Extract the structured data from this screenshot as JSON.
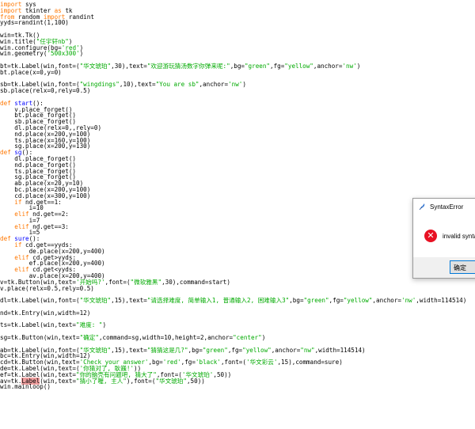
{
  "editor": {
    "lines": [
      [
        [
          "kw",
          "import"
        ],
        [
          "t",
          " sys"
        ]
      ],
      [
        [
          "kw",
          "import"
        ],
        [
          "t",
          " tkinter "
        ],
        [
          "kw",
          "as"
        ],
        [
          "t",
          " tk"
        ]
      ],
      [
        [
          "kw",
          "from"
        ],
        [
          "t",
          " random "
        ],
        [
          "kw",
          "import"
        ],
        [
          "t",
          " randint"
        ]
      ],
      [
        [
          "t",
          "yyds=randint(1,100)"
        ]
      ],
      [],
      [
        [
          "t",
          "win=tk.Tk()"
        ]
      ],
      [
        [
          "t",
          "win.title("
        ],
        [
          "st",
          "\"任宇轩nb\""
        ],
        [
          "t",
          ")"
        ]
      ],
      [
        [
          "t",
          "win.configure(bg="
        ],
        [
          "st",
          "'red'"
        ],
        [
          "t",
          ")"
        ]
      ],
      [
        [
          "t",
          "win.geometry("
        ],
        [
          "st",
          "'500x300'"
        ],
        [
          "t",
          ")"
        ]
      ],
      [],
      [
        [
          "t",
          "bt=tk.Label(win,font=("
        ],
        [
          "st",
          "\"华文琥珀\""
        ],
        [
          "t",
          ",30),text="
        ],
        [
          "st",
          "\"欢迎游玩猜汤数字你弹来呢:\""
        ],
        [
          "t",
          ",bg="
        ],
        [
          "st",
          "\"green\""
        ],
        [
          "t",
          ",fg="
        ],
        [
          "st",
          "\"yellow\""
        ],
        [
          "t",
          ",anchor="
        ],
        [
          "st",
          "'nw'"
        ],
        [
          "t",
          ")"
        ]
      ],
      [
        [
          "t",
          "bt.place(x=0,y=0)"
        ]
      ],
      [],
      [
        [
          "t",
          "sb=tk.Label(win,font=("
        ],
        [
          "st",
          "\"wingdings\""
        ],
        [
          "t",
          ",10),text="
        ],
        [
          "st",
          "\"You are sb\""
        ],
        [
          "t",
          ",anchor="
        ],
        [
          "st",
          "'nw'"
        ],
        [
          "t",
          ")"
        ]
      ],
      [
        [
          "t",
          "sb.place(relx=0,rely=0.5)"
        ]
      ],
      [],
      [
        [
          "kw",
          "def"
        ],
        [
          "t",
          " "
        ],
        [
          "fn",
          "start"
        ],
        [
          "t",
          "():"
        ]
      ],
      [
        [
          "t",
          "    v.place_forget()"
        ]
      ],
      [
        [
          "t",
          "    bt.place_forget()"
        ]
      ],
      [
        [
          "t",
          "    sb.place_forget()"
        ]
      ],
      [
        [
          "t",
          "    dl.place(relx=0,,rely=0)"
        ]
      ],
      [
        [
          "t",
          "    nd.place(x=200,y=100)"
        ]
      ],
      [
        [
          "t",
          "    ts.place(x=160,y=100)"
        ]
      ],
      [
        [
          "t",
          "    sg.place(x=200,y=130)"
        ]
      ],
      [
        [
          "kw",
          "def"
        ],
        [
          "t",
          " "
        ],
        [
          "fn",
          "sg"
        ],
        [
          "t",
          "():"
        ]
      ],
      [
        [
          "t",
          "    dl.place_forget()"
        ]
      ],
      [
        [
          "t",
          "    nd.place_forget()"
        ]
      ],
      [
        [
          "t",
          "    ts.place_forget()"
        ]
      ],
      [
        [
          "t",
          "    sg.place_forget()"
        ]
      ],
      [
        [
          "t",
          "    ab.place(x=20,y=10)"
        ]
      ],
      [
        [
          "t",
          "    bc.place(x=200,y=100)"
        ]
      ],
      [
        [
          "t",
          "    cd.place(x=300,y=100)"
        ]
      ],
      [
        [
          "t",
          "    "
        ],
        [
          "kw",
          "if"
        ],
        [
          "t",
          " nd.get==1:"
        ]
      ],
      [
        [
          "t",
          "        i=10"
        ]
      ],
      [
        [
          "t",
          "    "
        ],
        [
          "kw",
          "elif"
        ],
        [
          "t",
          " nd.get==2:"
        ]
      ],
      [
        [
          "t",
          "        i=7"
        ]
      ],
      [
        [
          "t",
          "    "
        ],
        [
          "kw",
          "elif"
        ],
        [
          "t",
          " nd.get==3:"
        ]
      ],
      [
        [
          "t",
          "        i=5"
        ]
      ],
      [
        [
          "kw",
          "def"
        ],
        [
          "t",
          " "
        ],
        [
          "fn",
          "sure"
        ],
        [
          "t",
          "():"
        ]
      ],
      [
        [
          "t",
          "    "
        ],
        [
          "kw",
          "if"
        ],
        [
          "t",
          " cd.get==yyds:"
        ]
      ],
      [
        [
          "t",
          "        de.place(x=200,y=400)"
        ]
      ],
      [
        [
          "t",
          "    "
        ],
        [
          "kw",
          "elif"
        ],
        [
          "t",
          " cd.get>yyds:"
        ]
      ],
      [
        [
          "t",
          "        ef.place(x=200,y=400)"
        ]
      ],
      [
        [
          "t",
          "    "
        ],
        [
          "kw",
          "elif"
        ],
        [
          "t",
          " cd.get<yyds:"
        ]
      ],
      [
        [
          "t",
          "        av.place(x=200,y=400)"
        ]
      ],
      [
        [
          "t",
          "v=tk.Button(win,text="
        ],
        [
          "st",
          "'开始吗?'"
        ],
        [
          "t",
          ",font=("
        ],
        [
          "st",
          "\"微软雅黑\""
        ],
        [
          "t",
          ",30),command=start)"
        ]
      ],
      [
        [
          "t",
          "v.place(relx=0.5,rely=0.5)"
        ]
      ],
      [],
      [
        [
          "t",
          "dl=tk.Label(win,font=("
        ],
        [
          "st",
          "\"华文琥珀\""
        ],
        [
          "t",
          ",15),text="
        ],
        [
          "st",
          "\"请选择难度, 简单输入1, 普通输入2, 困难输入3\""
        ],
        [
          "t",
          ",bg="
        ],
        [
          "st",
          "\"green\""
        ],
        [
          "t",
          ",fg="
        ],
        [
          "st",
          "\"yellow\""
        ],
        [
          "t",
          ",anchor="
        ],
        [
          "st",
          "'nw'"
        ],
        [
          "t",
          ",width=114514)"
        ]
      ],
      [],
      [
        [
          "t",
          "nd=tk.Entry(win,width=12)"
        ]
      ],
      [],
      [
        [
          "t",
          "ts=tk.Label(win,text="
        ],
        [
          "st",
          "\"难度: \""
        ],
        [
          "t",
          ")"
        ]
      ],
      [],
      [
        [
          "t",
          "sg=tk.Button(win,text="
        ],
        [
          "st",
          "\"确定\""
        ],
        [
          "t",
          ",command=sg,width=10,height=2,anchor="
        ],
        [
          "st",
          "\"center\""
        ],
        [
          "t",
          ")"
        ]
      ],
      [],
      [
        [
          "t",
          "ab=tk.Label(win,font=("
        ],
        [
          "st",
          "\"华文琥珀\""
        ],
        [
          "t",
          ",15),text="
        ],
        [
          "st",
          "\"猜猜这是几?\""
        ],
        [
          "t",
          ",bg="
        ],
        [
          "st",
          "\"green\""
        ],
        [
          "t",
          ",fg="
        ],
        [
          "st",
          "\"yellow\""
        ],
        [
          "t",
          ",anchor="
        ],
        [
          "st",
          "\"nw\""
        ],
        [
          "t",
          ",width=114514)"
        ]
      ],
      [
        [
          "t",
          "bc=tk.Entry(win,width=12)"
        ]
      ],
      [
        [
          "t",
          "cd=tk.Button(win,text="
        ],
        [
          "st",
          "'Check your answer'"
        ],
        [
          "t",
          ",bg="
        ],
        [
          "st",
          "'red'"
        ],
        [
          "t",
          ",fg="
        ],
        [
          "st",
          "'black'"
        ],
        [
          "t",
          ",font=("
        ],
        [
          "st",
          "'华文彩云'"
        ],
        [
          "t",
          ",15),command=sure)"
        ]
      ],
      [
        [
          "t",
          "de=tk.Label(win,text=("
        ],
        [
          "st",
          "'你猜对了, 耿巍!'"
        ],
        [
          "t",
          "))"
        ]
      ],
      [
        [
          "t",
          "ef=tk.Label(win,text="
        ],
        [
          "st",
          "\"你的脑壳有问题吧, 猜大了\""
        ],
        [
          "t",
          ",font=("
        ],
        [
          "st",
          "'华文琥珀'"
        ],
        [
          "t",
          ",50))"
        ]
      ],
      [
        [
          "t",
          "av=tk."
        ],
        [
          "hl",
          "Label"
        ],
        [
          "t",
          "(win,text="
        ],
        [
          "st",
          "\"猜小了喔, 主人\""
        ],
        [
          "t",
          "),font=("
        ],
        [
          "st",
          "\"华文琥珀\""
        ],
        [
          "t",
          ",50))"
        ]
      ],
      [
        [
          "t",
          "win.mainloop()"
        ]
      ]
    ]
  },
  "dialog": {
    "title": "SyntaxError",
    "message": "invalid syntax",
    "ok_label": "确定",
    "error_color": "#e81123"
  }
}
